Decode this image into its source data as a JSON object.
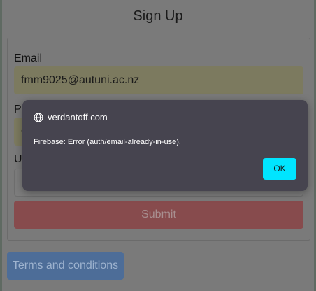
{
  "page": {
    "title": "Sign Up"
  },
  "form": {
    "email_label": "Email",
    "email_value": "fmm9025@autuni.ac.nz",
    "password_label_partial": "Pa",
    "password_masked_partial": "•",
    "username_label_partial": "U",
    "submit_label": "Submit"
  },
  "footer": {
    "terms_label": "Terms and conditions"
  },
  "dialog": {
    "host": "verdantoff.com",
    "message": "Firebase: Error (auth/email-already-in-use).",
    "ok_label": "OK",
    "icon": "globe-icon"
  },
  "colors": {
    "ok_button": "#00e5ff",
    "dialog_bg": "#46444f",
    "submit_bg": "#874b4d",
    "terms_bg": "#4d6d98"
  }
}
